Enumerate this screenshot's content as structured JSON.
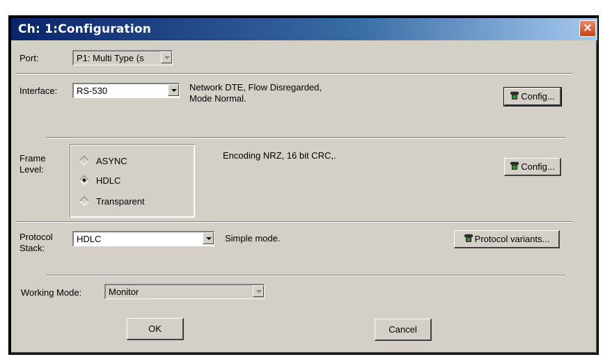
{
  "window": {
    "title": "Ch: 1:Configuration",
    "close_glyph": "×"
  },
  "port": {
    "label": "Port:",
    "value": "P1: Multi Type (s"
  },
  "interface": {
    "label": "Interface:",
    "value": "RS-530",
    "description_line1": "Network DTE, Flow Disregarded,",
    "description_line2": "Mode Normal.",
    "config_label": "Config..."
  },
  "frame_level": {
    "label_line1": "Frame",
    "label_line2": "Level:",
    "options": [
      {
        "label": "ASYNC",
        "checked": false
      },
      {
        "label": "HDLC",
        "checked": true
      },
      {
        "label": "Transparent",
        "checked": false
      }
    ],
    "description": "Encoding NRZ,  16 bit CRC,.",
    "config_label": "Config..."
  },
  "protocol_stack": {
    "label_line1": "Protocol",
    "label_line2": "Stack:",
    "value": "HDLC",
    "description": "Simple mode.",
    "variants_label": "Protocol variants..."
  },
  "working_mode": {
    "label": "Working Mode:",
    "value": "Monitor"
  },
  "buttons": {
    "ok": "OK",
    "cancel": "Cancel"
  },
  "icons": {
    "config": "network-config-icon",
    "close": "close-icon"
  }
}
